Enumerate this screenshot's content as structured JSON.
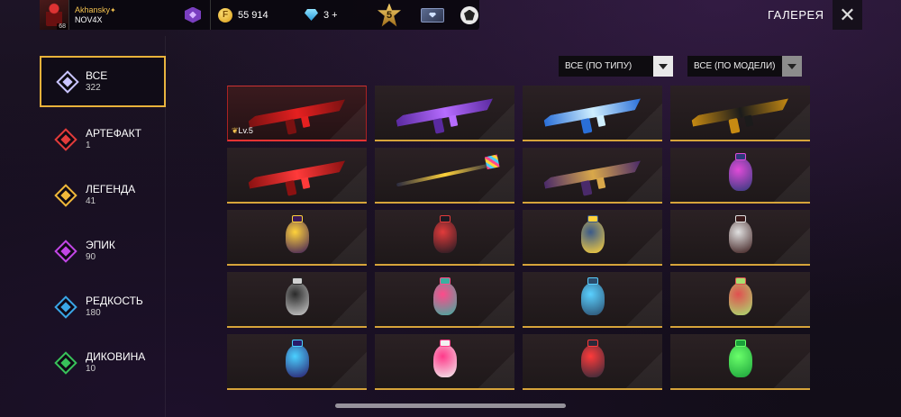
{
  "player": {
    "nickname": "Akhansky",
    "clan": "NOV4X",
    "level": "68"
  },
  "currency": {
    "gold": "55 914",
    "diamonds": "3 +"
  },
  "rank": {
    "value": "5"
  },
  "page": {
    "title": "ГАЛЕРЕЯ"
  },
  "filters": {
    "type": "ВСЕ (ПО ТИПУ)",
    "model": "ВСЕ (ПО МОДЕЛИ)"
  },
  "sidebar": {
    "items": [
      {
        "label": "ВСЕ",
        "count": "322",
        "color": "#c9c4ff"
      },
      {
        "label": "АРТЕФАКТ",
        "count": "1",
        "color": "#e23b3b"
      },
      {
        "label": "ЛЕГЕНДА",
        "count": "41",
        "color": "#f0b83a"
      },
      {
        "label": "ЭПИК",
        "count": "90",
        "color": "#c246e6"
      },
      {
        "label": "РЕДКОСТЬ",
        "count": "180",
        "color": "#3aa6e6"
      },
      {
        "label": "ДИКОВИНА",
        "count": "10",
        "color": "#38c25a"
      }
    ]
  },
  "grid": {
    "first_item_level": "Lv.5",
    "items": [
      {
        "kind": "gun",
        "colors": [
          "#7a1111",
          "#e52020"
        ],
        "tier": "artifact"
      },
      {
        "kind": "gun",
        "colors": [
          "#5a2aa0",
          "#b66cff"
        ]
      },
      {
        "kind": "gun",
        "colors": [
          "#2a6fd8",
          "#cfefff"
        ]
      },
      {
        "kind": "gun",
        "colors": [
          "#c68a12",
          "#1b1b1b"
        ]
      },
      {
        "kind": "gun",
        "colors": [
          "#8a1111",
          "#ff3a3a"
        ]
      },
      {
        "kind": "staff",
        "colors": [
          "#2a2a40",
          "#ffd23a"
        ]
      },
      {
        "kind": "gun",
        "colors": [
          "#4a2a6a",
          "#d9a84a"
        ]
      },
      {
        "kind": "nade",
        "colors": [
          "#2d3a7a",
          "#e04bd8"
        ]
      },
      {
        "kind": "nade",
        "colors": [
          "#3a1a5a",
          "#ffd23a"
        ]
      },
      {
        "kind": "nade",
        "colors": [
          "#1a1a22",
          "#e23b3b"
        ]
      },
      {
        "kind": "nade",
        "colors": [
          "#ffd23a",
          "#3a5a8a"
        ]
      },
      {
        "kind": "nade",
        "colors": [
          "#3a1a1a",
          "#e0e0e0"
        ]
      },
      {
        "kind": "nade",
        "colors": [
          "#d0d0d0",
          "#2a2a2a"
        ]
      },
      {
        "kind": "nade",
        "colors": [
          "#3ab0a0",
          "#ff4a8a"
        ]
      },
      {
        "kind": "nade",
        "colors": [
          "#2a4a6a",
          "#5ad0ff"
        ]
      },
      {
        "kind": "nade",
        "colors": [
          "#a8e070",
          "#e05050"
        ]
      },
      {
        "kind": "nade",
        "colors": [
          "#2a1a6a",
          "#4ad0ff"
        ]
      },
      {
        "kind": "nade",
        "colors": [
          "#f0f0f0",
          "#ff3a8a"
        ]
      },
      {
        "kind": "nade",
        "colors": [
          "#2a2a3a",
          "#ff3a3a"
        ]
      },
      {
        "kind": "nade",
        "colors": [
          "#1aa03a",
          "#6aff6a"
        ]
      }
    ]
  },
  "icons": [
    "close-icon",
    "coin-icon",
    "diamond-icon",
    "rank-badge-icon",
    "gallery-card-icon",
    "guild-icon",
    "vip-hex-icon"
  ]
}
